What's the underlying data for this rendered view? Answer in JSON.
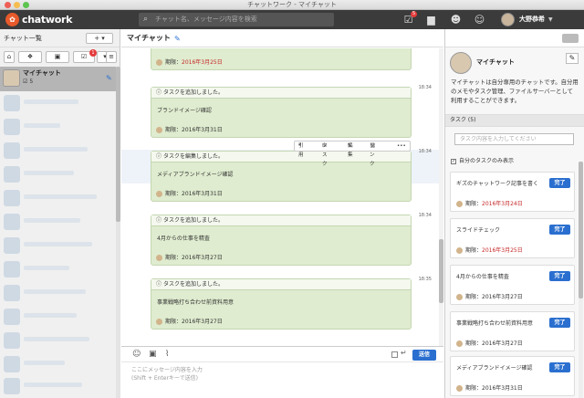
{
  "window": {
    "title": "チャットワーク - マイチャット"
  },
  "appbar": {
    "logo_text": "chatwork",
    "search_placeholder": "チャット名、メッセージ内容を検索",
    "task_badge": "5",
    "user_name": "大野恭希"
  },
  "sidebar": {
    "title": "チャット一覧",
    "add_label": "+ ▾",
    "filter_badge": "1",
    "active_room": {
      "name": "マイチャット",
      "task_count": "5"
    }
  },
  "main": {
    "title": "マイチャット",
    "messages": [
      {
        "time": "",
        "header": "",
        "body": "",
        "due_label": "期限：",
        "due": "2016年3月25日",
        "due_red": true
      },
      {
        "time": "18:34",
        "header": "タスクを追加しました。",
        "body": "ブランドイメージ確認",
        "due_label": "期限：",
        "due": "2016年3月31日",
        "due_red": false
      },
      {
        "time": "18:34",
        "header": "タスクを編集しました。",
        "body": "メディアブランドイメージ確認",
        "due_label": "期限：",
        "due": "2016年3月31日",
        "due_red": false
      },
      {
        "time": "18:34",
        "header": "タスクを追加しました。",
        "body": "4月からの仕事を精査",
        "due_label": "期限：",
        "due": "2016年3月27日",
        "due_red": false
      },
      {
        "time": "18:35",
        "header": "タスクを追加しました。",
        "body": "事業戦略打ち合わせ前資料用意",
        "due_label": "期限：",
        "due": "2016年3月27日",
        "due_red": false
      }
    ],
    "actions": {
      "quote": "引用",
      "task": "タスク",
      "edit": "編集",
      "link": "リンク",
      "more": "•••"
    },
    "composer": {
      "placeholder": "ここにメッセージ内容を入力",
      "hint": "(Shift + Enterキーで送信)",
      "send": "送信"
    }
  },
  "right": {
    "room_name": "マイチャット",
    "description": "マイチャットは自分専用のチャットです。自分用のメモやタスク管理、ファイルサーバーとして利用することができます。",
    "task_header": "タスク (5)",
    "task_input_placeholder": "タスク内容を入力してください",
    "mine_only_label": "自分のタスクのみ表示",
    "tasks": [
      {
        "title": "ギズのチャットワーク記事を書く",
        "done": "完了",
        "due_label": "期限：",
        "due": "2016年3月24日",
        "due_red": true
      },
      {
        "title": "スライドチェック",
        "done": "完了",
        "due_label": "期限：",
        "due": "2016年3月25日",
        "due_red": true
      },
      {
        "title": "4月からの仕事を精査",
        "done": "完了",
        "due_label": "期限：",
        "due": "2016年3月27日",
        "due_red": false
      },
      {
        "title": "事業戦略打ち合わせ前資料用意",
        "done": "完了",
        "due_label": "期限：",
        "due": "2016年3月27日",
        "due_red": false
      },
      {
        "title": "メディアブランドイメージ確認",
        "done": "完了",
        "due_label": "期限：",
        "due": "2016年3月31日",
        "due_red": false
      }
    ]
  }
}
